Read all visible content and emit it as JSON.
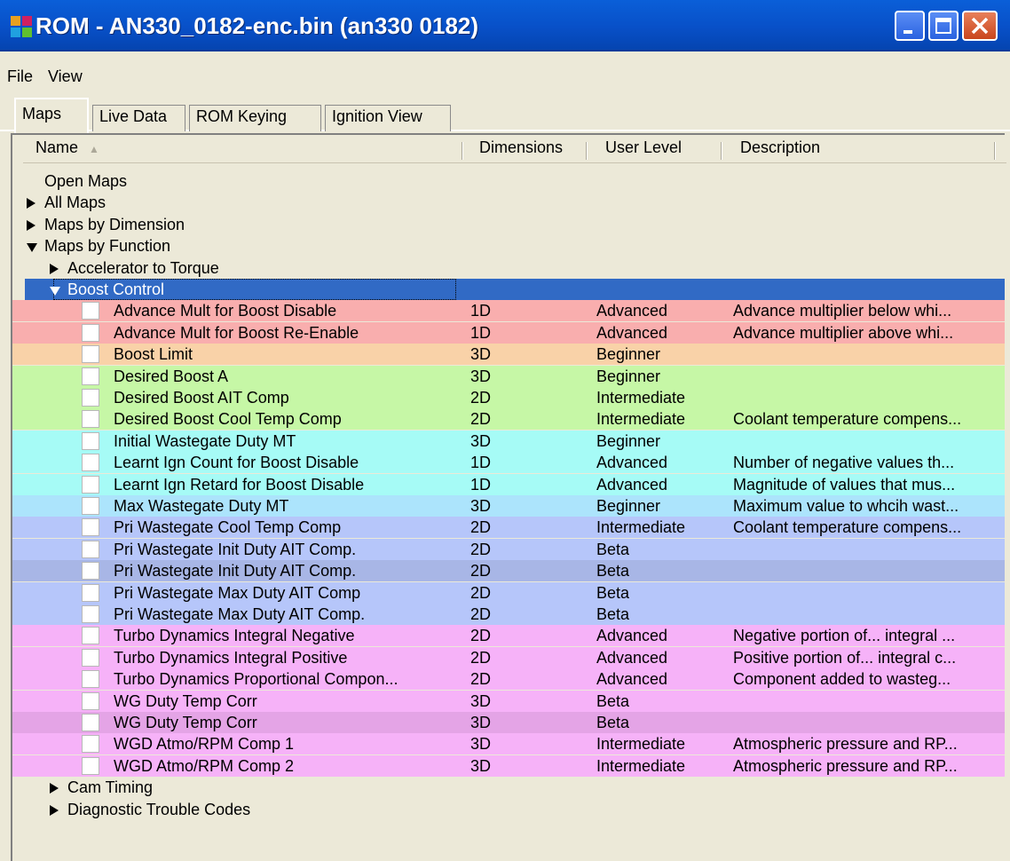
{
  "window": {
    "title": "ROM - AN330_0182-enc.bin (an330 0182)",
    "app_icon": "app-logo-icon",
    "controls": [
      "minimize-icon",
      "maximize-icon",
      "close-icon"
    ]
  },
  "menubar": {
    "items": [
      "File",
      "View"
    ]
  },
  "tabs": [
    "Maps",
    "Live Data",
    "ROM Keying",
    "Ignition View"
  ],
  "table": {
    "columns": [
      "Name",
      "Dimensions",
      "User Level",
      "Description"
    ],
    "tree": [
      {
        "label": "Open Maps",
        "level": 0,
        "expander": "none"
      },
      {
        "label": "All Maps",
        "level": 0,
        "expander": "collapsed"
      },
      {
        "label": "Maps by Dimension",
        "level": 0,
        "expander": "collapsed"
      },
      {
        "label": "Maps by Function",
        "level": 0,
        "expander": "expanded"
      },
      {
        "label": "Accelerator to Torque",
        "level": 1,
        "expander": "collapsed"
      },
      {
        "label": "Boost Control",
        "level": 1,
        "expander": "expanded",
        "selected": true
      }
    ],
    "maps": [
      {
        "name": "Advance Mult for Boost Disable",
        "dim": "1D",
        "level": "Advanced",
        "desc": "Advance multiplier below whi...",
        "color": "#f9aeae"
      },
      {
        "name": "Advance Mult for Boost Re-Enable",
        "dim": "1D",
        "level": "Advanced",
        "desc": "Advance multiplier above whi...",
        "color": "#f9aeae"
      },
      {
        "name": "Boost Limit",
        "dim": "3D",
        "level": "Beginner",
        "desc": "",
        "color": "#f9d2a8"
      },
      {
        "name": "Desired Boost A",
        "dim": "3D",
        "level": "Beginner",
        "desc": "",
        "color": "#c6f7a6"
      },
      {
        "name": "Desired Boost AIT Comp",
        "dim": "2D",
        "level": "Intermediate",
        "desc": "",
        "color": "#c6f7a6"
      },
      {
        "name": "Desired Boost Cool Temp Comp",
        "dim": "2D",
        "level": "Intermediate",
        "desc": "Coolant temperature compens...",
        "color": "#c6f7a6"
      },
      {
        "name": "Initial Wastegate Duty MT",
        "dim": "3D",
        "level": "Beginner",
        "desc": "",
        "color": "#a6fbf6"
      },
      {
        "name": "Learnt Ign Count for Boost Disable",
        "dim": "1D",
        "level": "Advanced",
        "desc": "Number of negative values th...",
        "color": "#a6fbf6"
      },
      {
        "name": "Learnt Ign Retard for Boost Disable",
        "dim": "1D",
        "level": "Advanced",
        "desc": "Magnitude of values that mus...",
        "color": "#a6fbf6"
      },
      {
        "name": "Max Wastegate Duty MT",
        "dim": "3D",
        "level": "Beginner",
        "desc": "Maximum value to whcih wast...",
        "color": "#ace4fc"
      },
      {
        "name": "Pri Wastegate Cool Temp Comp",
        "dim": "2D",
        "level": "Intermediate",
        "desc": "Coolant temperature compens...",
        "color": "#b6c6fa"
      },
      {
        "name": "Pri Wastegate Init Duty AIT Comp.",
        "dim": "2D",
        "level": "Beta",
        "desc": "",
        "color": "#b6c6fa"
      },
      {
        "name": "Pri Wastegate Init Duty AIT Comp.",
        "dim": "2D",
        "level": "Beta",
        "desc": "",
        "color": "#a8b6e6"
      },
      {
        "name": "Pri Wastegate Max Duty AIT Comp",
        "dim": "2D",
        "level": "Beta",
        "desc": "",
        "color": "#b6c6fa"
      },
      {
        "name": "Pri Wastegate Max Duty AIT Comp.",
        "dim": "2D",
        "level": "Beta",
        "desc": "",
        "color": "#b6c6fa"
      },
      {
        "name": "Turbo Dynamics Integral Negative",
        "dim": "2D",
        "level": "Advanced",
        "desc": "Negative portion of... integral ...",
        "color": "#f6b2f8"
      },
      {
        "name": "Turbo Dynamics Integral Positive",
        "dim": "2D",
        "level": "Advanced",
        "desc": "Positive portion of... integral c...",
        "color": "#f6b2f8"
      },
      {
        "name": "Turbo Dynamics Proportional Compon...",
        "dim": "2D",
        "level": "Advanced",
        "desc": "Component added to wasteg...",
        "color": "#f6b2f8"
      },
      {
        "name": "WG Duty Temp Corr",
        "dim": "3D",
        "level": "Beta",
        "desc": "",
        "color": "#f6b2f8"
      },
      {
        "name": "WG Duty Temp Corr",
        "dim": "3D",
        "level": "Beta",
        "desc": "",
        "color": "#e4a4e6"
      },
      {
        "name": "WGD Atmo/RPM Comp 1",
        "dim": "3D",
        "level": "Intermediate",
        "desc": "Atmospheric pressure and RP...",
        "color": "#f6b2f8"
      },
      {
        "name": "WGD Atmo/RPM Comp 2",
        "dim": "3D",
        "level": "Intermediate",
        "desc": "Atmospheric pressure and RP...",
        "color": "#f6b2f8"
      }
    ],
    "tail": [
      {
        "label": "Cam Timing",
        "level": 1,
        "expander": "collapsed"
      },
      {
        "label": "Diagnostic Trouble Codes",
        "level": 1,
        "expander": "collapsed"
      }
    ]
  },
  "colors": {
    "selection": "#316ac5",
    "titlebar": "#0a5fd8"
  }
}
